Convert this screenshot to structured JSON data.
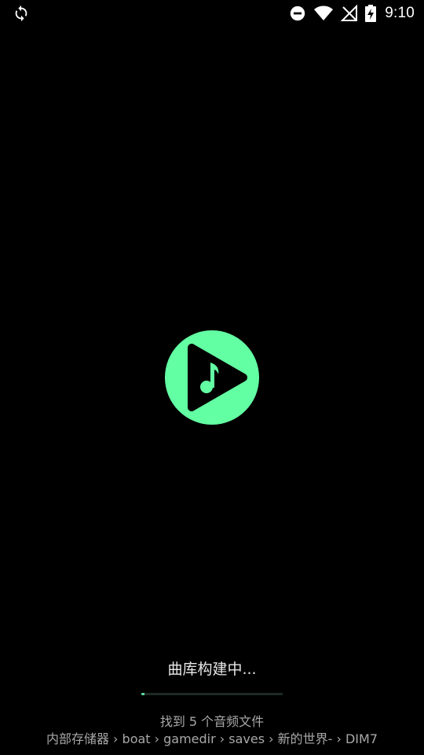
{
  "status_bar": {
    "sync_icon": "sync-icon",
    "dnd_icon": "do-not-disturb-icon",
    "wifi_icon": "wifi-icon",
    "signal_icon": "no-signal-icon",
    "battery_icon": "battery-charging-icon",
    "time": "9:10"
  },
  "app": {
    "logo_icon": "music-play-logo-icon",
    "accent_color": "#63FFA3"
  },
  "loading": {
    "label": "曲库构建中...",
    "progress_percent": 2,
    "found_text": "找到 5 个音频文件",
    "path": "内部存储器 › boat › gamedir › saves › 新的世界- › DIM7"
  }
}
